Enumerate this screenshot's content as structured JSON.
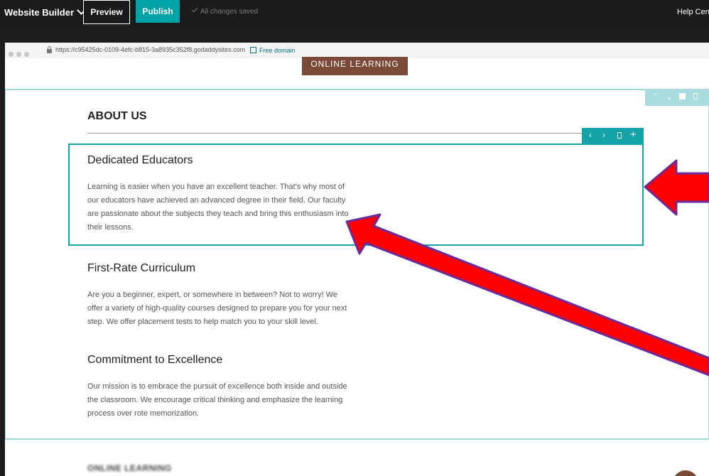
{
  "toolbar": {
    "brand": "Website Builder",
    "preview_label": "Preview",
    "publish_label": "Publish",
    "saved_status": "All changes saved",
    "help_label": "Help Cente"
  },
  "browser": {
    "url": "https://c95425dc-0109-4efc-b815-3a8935c352f8.godaddysites.com",
    "free_domain_label": "Free domain"
  },
  "page": {
    "top_nav_label": "ONLINE LEARNING",
    "section_title": "ABOUT US",
    "items": [
      {
        "heading": "Dedicated Educators",
        "body": "Learning is easier when you have an excellent teacher. That's why most of our educators have achieved an advanced degree in their field. Our faculty are passionate about the subjects they teach and bring this enthusiasm into their lessons."
      },
      {
        "heading": "First-Rate Curriculum",
        "body": "Are you a beginner, expert, or somewhere in between? Not to worry! We offer a variety of high-quality courses designed to prepare you for your next step. We offer placement tests to help match you to your skill level."
      },
      {
        "heading": "Commitment to Excellence",
        "body": "Our mission is to embrace the pursuit of excellence both inside and outside the classroom. We encourage critical thinking and emphasize the learning process over rote memorization."
      }
    ],
    "next_section_title": "ONLINE LEARNING"
  },
  "icons": {
    "block_tools": [
      "chevron-left-icon",
      "chevron-right-icon",
      "trash-icon",
      "plus-icon"
    ],
    "section_tools": [
      "chevron-up-icon",
      "chevron-down-icon",
      "layout-icon",
      "trash-icon"
    ]
  },
  "colors": {
    "accent_teal": "#14a3a6",
    "publish": "#00a4a6",
    "brand_brown": "#7b4a36",
    "annotation_red": "#ff0000",
    "annotation_outline": "#6a2a9a"
  }
}
